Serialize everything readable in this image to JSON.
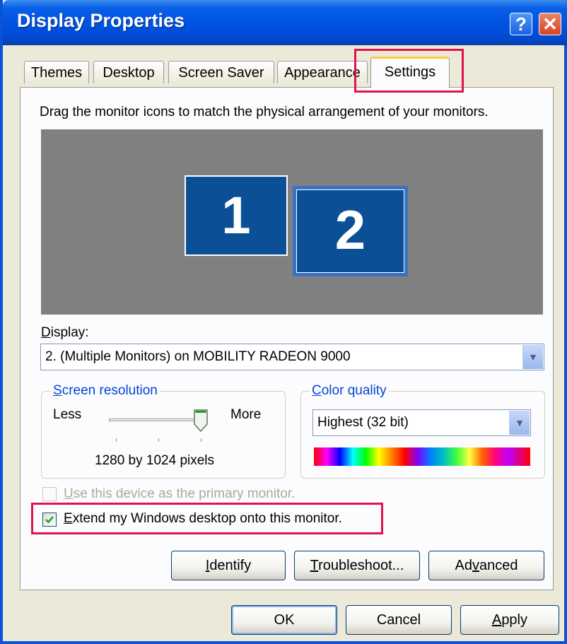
{
  "window": {
    "title": "Display Properties",
    "help_glyph": "?",
    "close_glyph": "✕"
  },
  "tabs": [
    {
      "label": "Themes"
    },
    {
      "label": "Desktop"
    },
    {
      "label": "Screen Saver"
    },
    {
      "label": "Appearance"
    },
    {
      "label": "Settings",
      "active": true
    }
  ],
  "settings": {
    "instructions": "Drag the monitor icons to match the physical arrangement of your monitors.",
    "monitors": [
      {
        "label": "1"
      },
      {
        "label": "2",
        "selected": true
      }
    ],
    "display": {
      "label_first": "D",
      "label_rest": "isplay:",
      "value": "2. (Multiple Monitors) on MOBILITY RADEON 9000"
    },
    "screen_resolution": {
      "legend_first": "S",
      "legend_rest": "creen resolution",
      "less_label": "Less",
      "more_label": "More",
      "value_text": "1280 by 1024 pixels",
      "slider_level": 1.0
    },
    "color_quality": {
      "legend_first": "C",
      "legend_rest": "olor quality",
      "value": "Highest (32 bit)"
    },
    "primary_checkbox": {
      "label_first": "U",
      "label_rest": "se this device as the primary monitor.",
      "checked": false,
      "disabled": true
    },
    "extend_checkbox": {
      "label_first": "E",
      "label_rest": "xtend my Windows desktop onto this monitor.",
      "checked": true
    },
    "buttons": {
      "identify": {
        "first": "I",
        "rest": "dentify"
      },
      "troubleshoot": {
        "first": "T",
        "rest": "roubleshoot..."
      },
      "advanced": {
        "pre": "Ad",
        "mn": "v",
        "post": "anced"
      }
    }
  },
  "footer": {
    "ok": "OK",
    "cancel": "Cancel",
    "apply": {
      "first": "A",
      "rest": "pply"
    }
  },
  "colors": {
    "title_blue": "#0054e3",
    "highlight": "#e0144a",
    "monitor_blue": "#0b5096",
    "dialog_bg": "#ece9d8"
  }
}
